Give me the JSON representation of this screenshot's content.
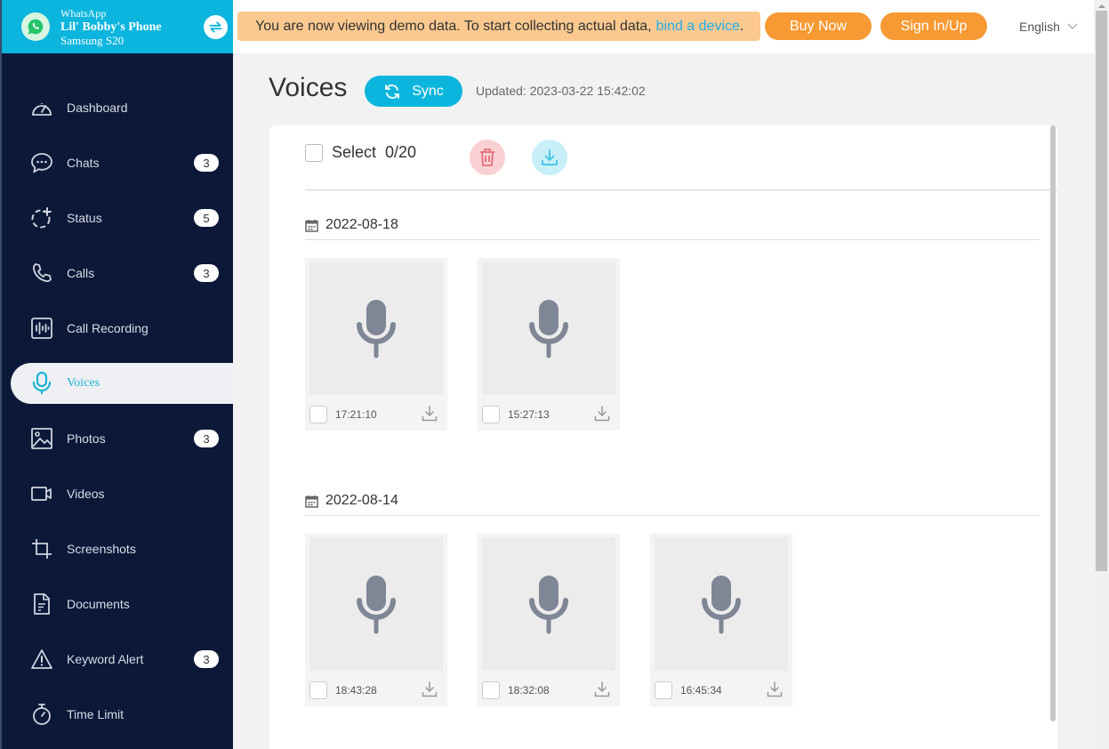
{
  "device": {
    "app": "WhatsApp",
    "name": "Lil' Bobby's Phone",
    "model": "Samsung S20"
  },
  "sidebar": {
    "items": [
      {
        "label": "Dashboard",
        "icon": "dashboard-icon",
        "badge": null
      },
      {
        "label": "Chats",
        "icon": "chat-icon",
        "badge": "3"
      },
      {
        "label": "Status",
        "icon": "status-icon",
        "badge": "5"
      },
      {
        "label": "Calls",
        "icon": "phone-icon",
        "badge": "3"
      },
      {
        "label": "Call Recording",
        "icon": "call-recording-icon",
        "badge": null
      },
      {
        "label": "Voices",
        "icon": "microphone-icon",
        "badge": null,
        "active": true
      },
      {
        "label": "Photos",
        "icon": "photo-icon",
        "badge": "3"
      },
      {
        "label": "Videos",
        "icon": "video-icon",
        "badge": null
      },
      {
        "label": "Screenshots",
        "icon": "crop-icon",
        "badge": null
      },
      {
        "label": "Documents",
        "icon": "document-icon",
        "badge": null
      },
      {
        "label": "Keyword Alert",
        "icon": "warning-icon",
        "badge": "3"
      },
      {
        "label": "Time Limit",
        "icon": "stopwatch-icon",
        "badge": null
      }
    ]
  },
  "topbar": {
    "banner_text": "You are now viewing demo data. To start collecting actual data,",
    "banner_link": "bind a device",
    "banner_end": ".",
    "buy_label": "Buy Now",
    "sign_label": "Sign In/Up",
    "language": "English"
  },
  "page": {
    "title": "Voices",
    "sync_label": "Sync",
    "updated": "Updated: 2023-03-22 15:42:02"
  },
  "toolbar": {
    "select_label": "Select",
    "select_count": "0/20"
  },
  "groups": [
    {
      "date": "2022-08-18",
      "items": [
        {
          "time": "17:21:10"
        },
        {
          "time": "15:27:13"
        }
      ]
    },
    {
      "date": "2022-08-14",
      "items": [
        {
          "time": "18:43:28"
        },
        {
          "time": "18:32:08"
        },
        {
          "time": "16:45:34"
        }
      ]
    }
  ],
  "colors": {
    "accent": "#0cb5dd",
    "sidebar_bg": "#0b1838",
    "orange": "#f89a33",
    "banner_bg": "#fbc98f"
  }
}
